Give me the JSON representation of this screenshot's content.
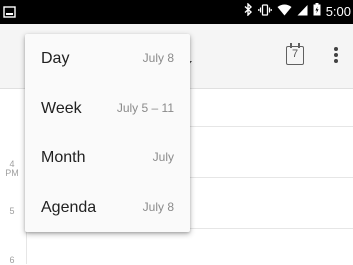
{
  "status_bar": {
    "time": "5:00",
    "icons": [
      "screenshot-icon",
      "bluetooth-icon",
      "vibrate-icon",
      "wifi-icon",
      "signal-icon",
      "battery-icon"
    ]
  },
  "toolbar": {
    "calendar_day": "7",
    "icons": [
      "dropdown-caret-icon",
      "today-calendar-icon",
      "more-vert-icon"
    ]
  },
  "time_grid": {
    "hour_labels": [
      "4",
      "PM",
      "5",
      "6"
    ]
  },
  "view_menu": {
    "items": [
      {
        "label": "Day",
        "date": "July 8"
      },
      {
        "label": "Week",
        "date": "July 5 – 11"
      },
      {
        "label": "Month",
        "date": "July"
      },
      {
        "label": "Agenda",
        "date": "July 8"
      }
    ]
  },
  "colors": {
    "status_bar": "#000000",
    "toolbar": "#f5f5f5",
    "menu": "#fafafa",
    "text_primary": "#212121",
    "text_secondary": "#8a8a8a",
    "grid_line": "#e6e6e6"
  }
}
